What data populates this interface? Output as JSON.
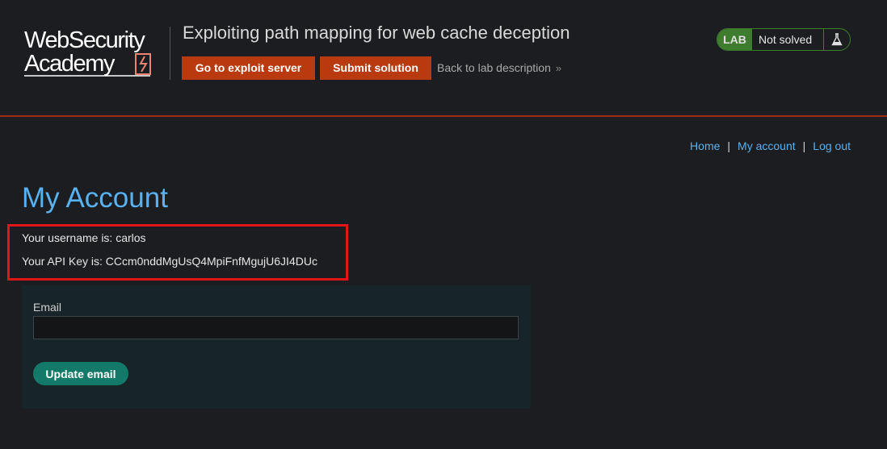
{
  "header": {
    "logo_line1": "WebSecurity",
    "logo_line2": "Academy",
    "lab_title": "Exploiting path mapping for web cache deception",
    "exploit_button": "Go to exploit server",
    "submit_button": "Submit solution",
    "back_link": "Back to lab description",
    "back_link_icon": "double-chevron-right-icon",
    "status": {
      "tag": "LAB",
      "label": "Not solved",
      "icon": "flask-icon"
    }
  },
  "nav": {
    "home": "Home",
    "separator": "|",
    "account": "My account",
    "logout": "Log out"
  },
  "main": {
    "title": "My Account",
    "username_line": "Your username is: carlos",
    "api_key_line": "Your API Key is: CCcm0nddMgUsQ4MpiFnfMgujU6JI4DUc",
    "email_label": "Email",
    "email_value": "",
    "update_button": "Update email"
  },
  "colors": {
    "accent_blue": "#58b1f0",
    "brand_orange": "#b83a0e",
    "status_green": "#3e7d2e",
    "button_teal": "#137a69",
    "highlight_red": "#e0161b"
  }
}
